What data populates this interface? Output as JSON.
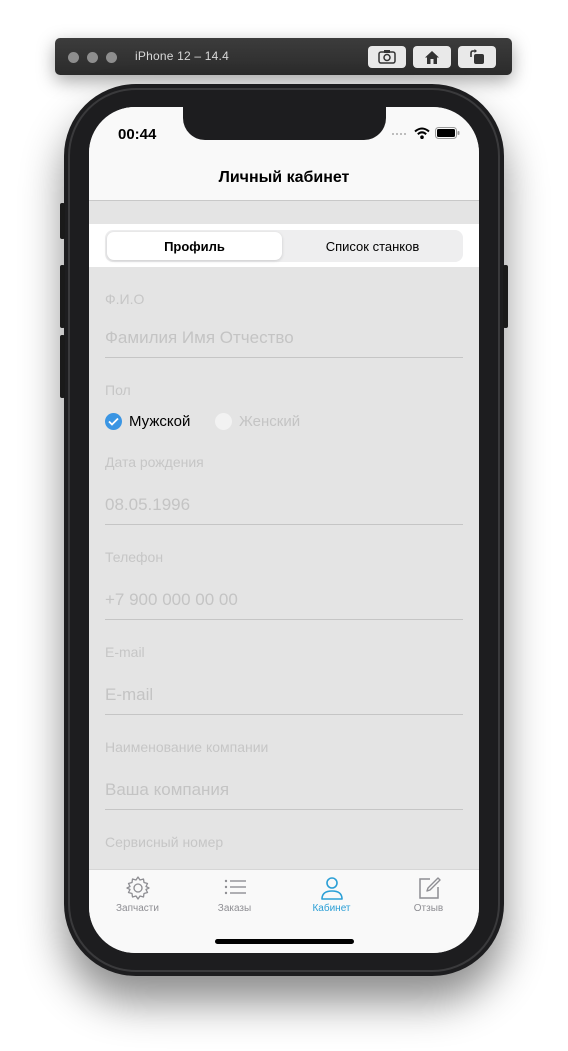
{
  "simulator": {
    "title": "iPhone 12 – 14.4",
    "buttons": [
      "screenshot-icon",
      "home-icon",
      "rotate-icon"
    ]
  },
  "status_bar": {
    "time": "00:44",
    "icons": [
      "signal-icon",
      "wifi-icon",
      "battery-icon"
    ]
  },
  "navbar": {
    "title": "Личный кабинет"
  },
  "segments": {
    "active": "Профиль",
    "inactive": "Список станков"
  },
  "form": {
    "fio_label": "Ф.И.О",
    "fio_placeholder": "Фамилия Имя Отчество",
    "gender_label": "Пол",
    "gender_male": "Мужской",
    "gender_female": "Женский",
    "gender_selected": "Мужской",
    "birth_label": "Дата рождения",
    "birth_value": "08.05.1996",
    "phone_label": "Телефон",
    "phone_placeholder": "+7 900 000 00 00",
    "email_label": "E-mail",
    "email_placeholder": "E-mail",
    "company_label": "Наименование компании",
    "company_placeholder": "Ваша компания",
    "service_label": "Сервисный номер"
  },
  "tabbar": {
    "items": [
      {
        "label": "Запчасти",
        "icon": "gear-icon",
        "active": false
      },
      {
        "label": "Заказы",
        "icon": "list-icon",
        "active": false
      },
      {
        "label": "Кабинет",
        "icon": "person-icon",
        "active": true
      },
      {
        "label": "Отзыв",
        "icon": "compose-icon",
        "active": false
      }
    ]
  },
  "colors": {
    "accent": "#2b9fd6",
    "radio_selected": "#3a95e3",
    "placeholder": "#c4c4c4",
    "background": "#e4e4e4"
  }
}
